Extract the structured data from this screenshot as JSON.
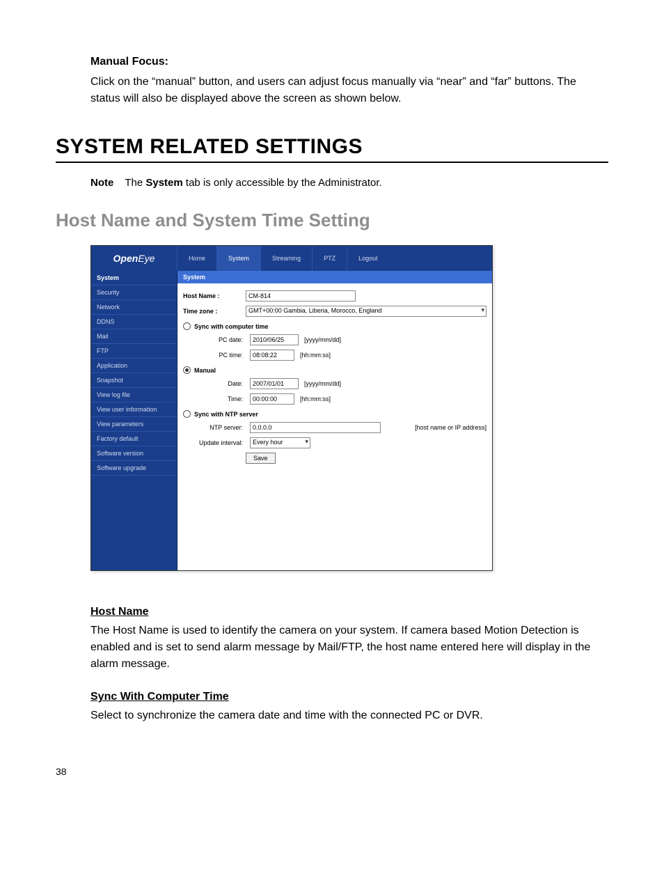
{
  "doc": {
    "manual_focus_head": "Manual Focus:",
    "manual_focus_body": "Click on the “manual” button, and users can adjust focus manually via “near” and “far” buttons. The status will also be displayed above the screen as shown below.",
    "h1": "SYSTEM RELATED SETTINGS",
    "note_label": "Note",
    "note_pre": "The ",
    "note_bold": "System",
    "note_post": " tab is only accessible by the Administrator.",
    "h2": "Host Name and System Time Setting",
    "hostname_head": "Host Name",
    "hostname_body": "The Host Name is used to identify the camera on your system. If camera based Motion Detection is enabled and is set to send alarm message by Mail/FTP, the host name entered here will display in the alarm message.",
    "sync_head": "Sync With Computer Time",
    "sync_body": "Select to synchronize the camera date and time with the connected PC or DVR.",
    "page_number": "38"
  },
  "ui": {
    "logo_bold": "Open",
    "logo_thin": "Eye",
    "tabs": [
      "Home",
      "System",
      "Streaming",
      "PTZ",
      "Logout"
    ],
    "active_tab": "System",
    "sidebar": [
      "System",
      "Security",
      "Network",
      "DDNS",
      "Mail",
      "FTP",
      "Application",
      "Snapshot",
      "View log file",
      "View user information",
      "View parameters",
      "Factory default",
      "Software version",
      "Software upgrade"
    ],
    "active_sidebar": "System",
    "panel_title": "System",
    "hostname_label": "Host Name :",
    "hostname_value": "CM-814",
    "timezone_label": "Time zone :",
    "timezone_value": "GMT+00:00 Gambia, Liberia, Morocco, England",
    "opt_sync_pc": "Sync with computer time",
    "pc_date_label": "PC date:",
    "pc_date_value": "2010/06/25",
    "pc_date_hint": "[yyyy/mm/dd]",
    "pc_time_label": "PC time:",
    "pc_time_value": "08:08:22",
    "pc_time_hint": "[hh:mm:ss]",
    "opt_manual": "Manual",
    "m_date_label": "Date:",
    "m_date_value": "2007/01/01",
    "m_date_hint": "[yyyy/mm/dd]",
    "m_time_label": "Time:",
    "m_time_value": "00:00:00",
    "m_time_hint": "[hh:mm:ss]",
    "opt_sync_ntp": "Sync with NTP server",
    "ntp_label": "NTP server:",
    "ntp_value": "0.0.0.0",
    "ntp_hint": "[host name or IP address]",
    "upd_label": "Update interval:",
    "upd_value": "Every hour",
    "save": "Save"
  }
}
